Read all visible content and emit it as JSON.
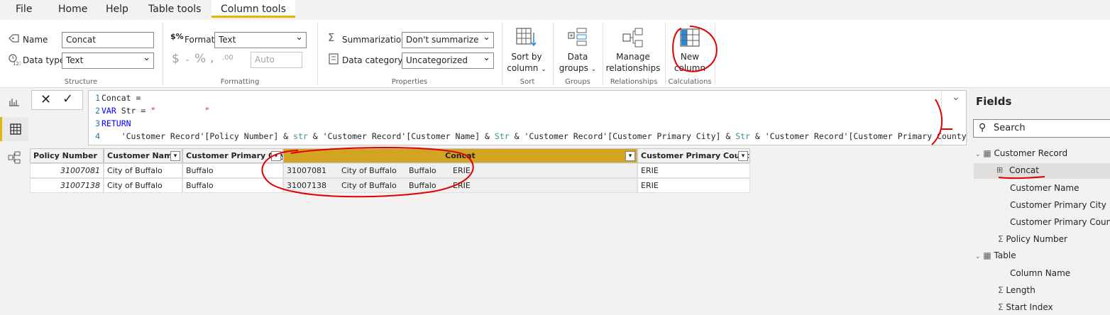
{
  "tabs": [
    "File",
    "Home",
    "Help",
    "Table tools",
    "Column tools"
  ],
  "structure": {
    "name_label": "Name",
    "name_value": "Concat",
    "datatype_label": "Data type",
    "datatype_value": "Text",
    "group_label": "Structure"
  },
  "formatting": {
    "format_label": "Format",
    "format_value": "Text",
    "currency_symbol": "$",
    "percent_symbol": "%",
    "comma_symbol": ",",
    "decimals_symbol": ".00",
    "auto_value": "Auto",
    "group_label": "Formatting"
  },
  "properties": {
    "summarization_label": "Summarization",
    "summarization_value": "Don't summarize",
    "category_label": "Data category",
    "category_value": "Uncategorized",
    "group_label": "Properties"
  },
  "sort": {
    "label_line1": "Sort by",
    "label_line2": "column",
    "group_label": "Sort"
  },
  "groups": {
    "label_line1": "Data",
    "label_line2": "groups",
    "group_label": "Groups"
  },
  "relationships": {
    "label_line1": "Manage",
    "label_line2": "relationships",
    "group_label": "Relationships"
  },
  "calculations": {
    "label_line1": "New",
    "label_line2": "column",
    "group_label": "Calculations"
  },
  "formula": {
    "lines": [
      {
        "num": "1",
        "text": "Concat ="
      },
      {
        "num": "2",
        "kw": "VAR",
        "mid": " Str = ",
        "str": "\"          \""
      },
      {
        "num": "3",
        "kw": "RETURN"
      },
      {
        "num": "4",
        "text": "    'Customer Record'[Policy Number] & ",
        "id1": "str",
        "t2": " & 'Customer Record'[Customer Name] & ",
        "id2": "Str",
        "t3": " & 'Customer Record'[Customer Primary City] & ",
        "id3": "Str",
        "t4": " & 'Customer Record'[Customer Primary County]"
      }
    ]
  },
  "table": {
    "columns": [
      "Policy Number",
      "Customer Name",
      "Customer Primary City",
      "Concat",
      "Customer Primary County"
    ],
    "rows": [
      {
        "policy": "31007081",
        "name": "City of Buffalo",
        "city": "Buffalo",
        "c1": "31007081",
        "c2": "City of Buffalo",
        "c3": "Buffalo",
        "c4": "ERIE",
        "county": "ERIE"
      },
      {
        "policy": "31007138",
        "name": "City of Buffalo",
        "city": "Buffalo",
        "c1": "31007138",
        "c2": "City of Buffalo",
        "c3": "Buffalo",
        "c4": "ERIE",
        "county": "ERIE"
      }
    ]
  },
  "fields_pane": {
    "title": "Fields",
    "search_placeholder": "Search",
    "items": [
      "Customer Record",
      "Concat",
      "Customer Name",
      "Customer Primary City",
      "Customer Primary County",
      "Policy Number",
      "Table",
      "Column Name",
      "Length",
      "Start Index"
    ]
  },
  "colors": {
    "accent": "#e3b505",
    "selected_header": "#d1a421",
    "annotation": "#e00000"
  }
}
